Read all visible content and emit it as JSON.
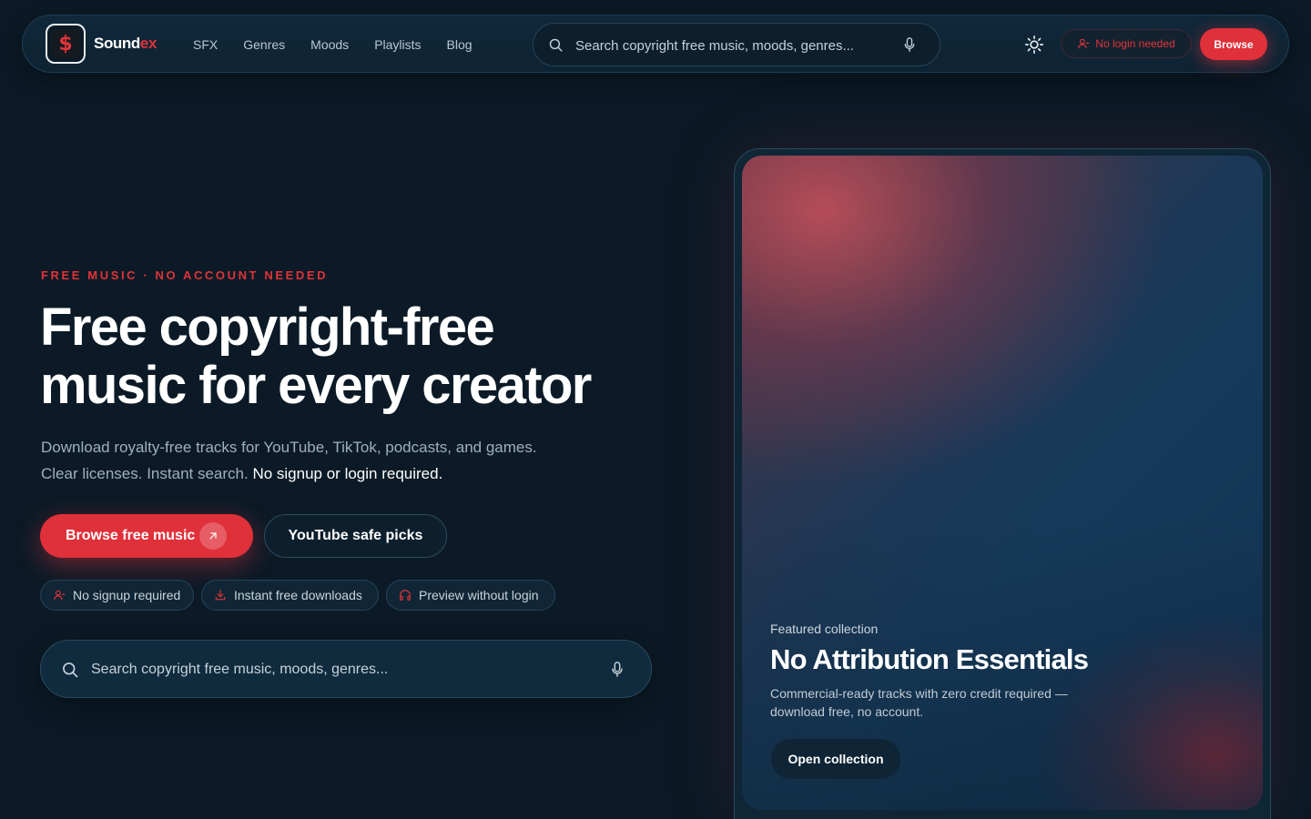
{
  "brand": {
    "name_main": "Sound",
    "name_accent": "ex",
    "logo_glyph": "$",
    "accent_color": "#e0343a"
  },
  "nav": {
    "links": [
      "SFX",
      "Genres",
      "Moods",
      "Playlists",
      "Blog"
    ],
    "search_placeholder": "Search copyright free music, moods, genres...",
    "no_login_label": "No login needed",
    "browse_label": "Browse"
  },
  "hero": {
    "eyebrow": "FREE MUSIC · NO ACCOUNT NEEDED",
    "headline_line1": "Free copyright-free",
    "headline_line2": "music for every creator",
    "subcopy_main": "Download royalty-free tracks for YouTube, TikTok, podcasts, and games. Clear licenses. Instant search.",
    "subcopy_strong": "No signup or login required.",
    "primary_cta": "Browse free music",
    "secondary_cta": "YouTube safe picks",
    "chips": [
      {
        "label": "No signup required",
        "icon": "user-icon"
      },
      {
        "label": "Instant free downloads",
        "icon": "download-icon"
      },
      {
        "label": "Preview without login",
        "icon": "headphones-icon"
      }
    ],
    "search_placeholder": "Search copyright free music, moods, genres..."
  },
  "featured": {
    "label": "Featured collection",
    "title": "No Attribution Essentials",
    "description": "Commercial-ready tracks with zero credit required — download free, no account.",
    "button": "Open collection"
  }
}
